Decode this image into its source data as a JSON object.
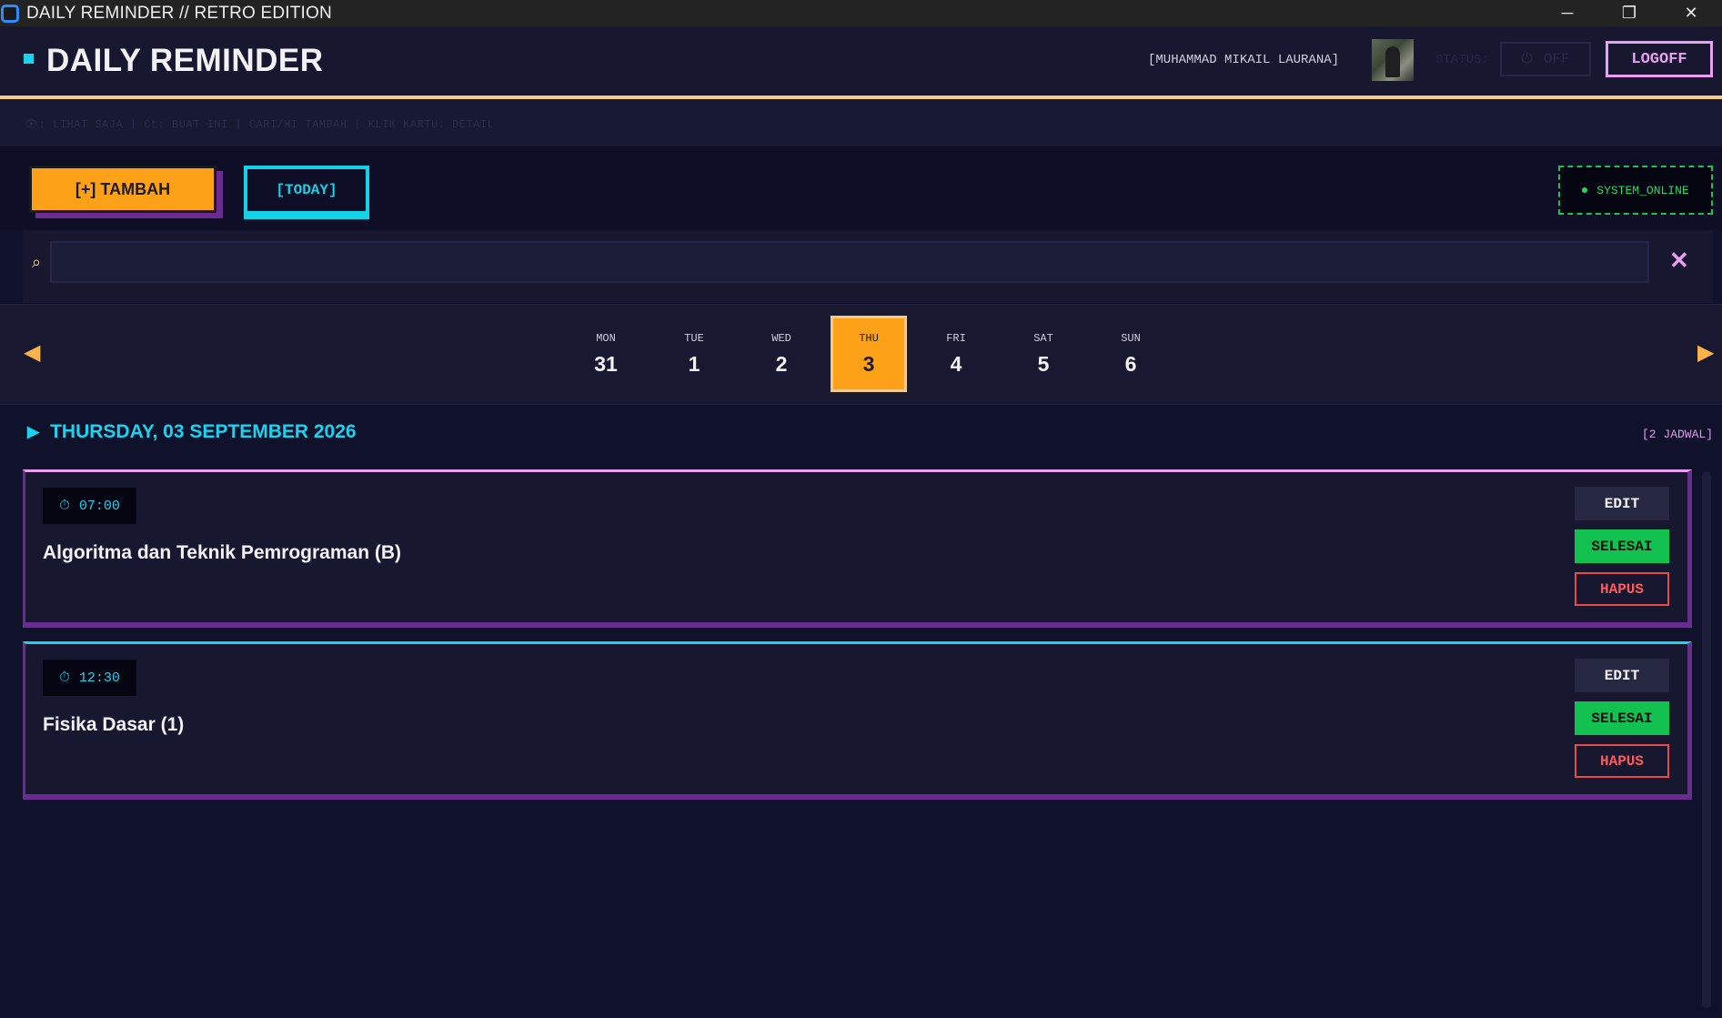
{
  "window": {
    "title": "DAILY REMINDER // RETRO EDITION",
    "controls": {
      "minimize": "─",
      "maximize": "❐",
      "close": "✕"
    }
  },
  "header": {
    "app_title": "DAILY REMINDER",
    "user_name": "[MUHAMMAD MIKAIL LAURANA]",
    "status_label": "STATUS:",
    "status_toggle": "OFF",
    "logoff": "LOGOFF"
  },
  "hints": {
    "text": "👁: LIHAT SAJA  |  Ct: BUAT INI  |  CARI/HI TAMBAH  |  KLIK KARTU: DETAIL"
  },
  "toolbar": {
    "add_label": "[+] TAMBAH",
    "today_label": "[TODAY]",
    "system_status": "SYSTEM_ONLINE"
  },
  "search": {
    "value": "",
    "placeholder": "",
    "clear": "✕",
    "icon": "⌕"
  },
  "week": {
    "prev": "◀",
    "next": "▶",
    "days": [
      {
        "name": "MON",
        "num": "31",
        "active": false
      },
      {
        "name": "TUE",
        "num": "1",
        "active": false
      },
      {
        "name": "WED",
        "num": "2",
        "active": false
      },
      {
        "name": "THU",
        "num": "3",
        "active": true
      },
      {
        "name": "FRI",
        "num": "4",
        "active": false
      },
      {
        "name": "SAT",
        "num": "5",
        "active": false
      },
      {
        "name": "SUN",
        "num": "6",
        "active": false
      }
    ]
  },
  "date_heading": {
    "arrow": "▶",
    "text": "THURSDAY, 03 SEPTEMBER 2026",
    "count": "[2 JADWAL]"
  },
  "schedules": [
    {
      "time": "07:00",
      "title": "Algoritma dan Teknik Pemrograman (B)",
      "accent": "#e8a0f0"
    },
    {
      "time": "12:30",
      "title": "Fisika Dasar (1)",
      "accent": "#19d3f0"
    }
  ],
  "actions": {
    "edit": "EDIT",
    "done": "SELESAI",
    "delete": "HAPUS"
  },
  "colors": {
    "background": "#10112a",
    "accent_orange": "#fda119",
    "accent_cyan": "#19d3f0",
    "accent_pink": "#e8a0f0",
    "accent_purple": "#6b2b93",
    "status_green": "#1fdc67"
  }
}
